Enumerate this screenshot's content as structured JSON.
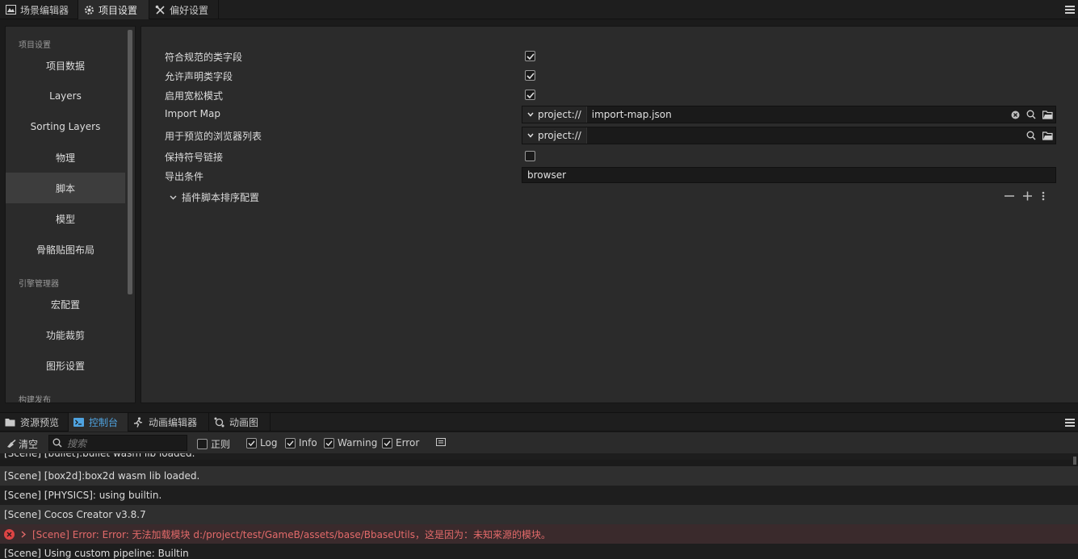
{
  "top_tabs": [
    {
      "label": "场景编辑器",
      "icon": "scene-icon"
    },
    {
      "label": "项目设置",
      "icon": "gear-icon",
      "active": true
    },
    {
      "label": "偏好设置",
      "icon": "tools-icon"
    }
  ],
  "nav": {
    "section_project": "项目设置",
    "items_project": [
      "项目数据",
      "Layers",
      "Sorting Layers",
      "物理",
      "脚本",
      "模型",
      "骨骼贴图布局"
    ],
    "active": "脚本",
    "section_engine": "引擎管理器",
    "items_engine": [
      "宏配置",
      "功能裁剪",
      "图形设置"
    ],
    "section_build": "构建发布"
  },
  "settings": {
    "strict_class_fields": {
      "label": "符合规范的类字段",
      "checked": true
    },
    "allow_declare_fields": {
      "label": "允许声明类字段",
      "checked": true
    },
    "loose_mode": {
      "label": "启用宽松模式",
      "checked": true
    },
    "import_map": {
      "label": "Import Map",
      "prefix": "project://",
      "value": "import-map.json"
    },
    "preview_browsers": {
      "label": "用于预览的浏览器列表",
      "prefix": "project://",
      "value": ""
    },
    "preserve_symlinks": {
      "label": "保持符号链接",
      "checked": false
    },
    "export_conditions": {
      "label": "导出条件",
      "value": "browser"
    },
    "plugin_order": {
      "label": "插件脚本排序配置"
    }
  },
  "bottom_tabs": [
    {
      "label": "资源预览",
      "icon": "folder-icon"
    },
    {
      "label": "控制台",
      "icon": "terminal-icon",
      "active": true
    },
    {
      "label": "动画编辑器",
      "icon": "runner-icon"
    },
    {
      "label": "动画图",
      "icon": "animgraph-icon"
    }
  ],
  "console_toolbar": {
    "clear_label": "清空",
    "search_placeholder": "搜索",
    "regex_label": "正则",
    "regex_checked": false,
    "log_label": "Log",
    "info_label": "Info",
    "warning_label": "Warning",
    "error_label": "Error"
  },
  "logs": [
    {
      "text": "[Scene] [bullet]:bullet wasm lib loaded.",
      "level": "log"
    },
    {
      "text": "[Scene] [box2d]:box2d wasm lib loaded.",
      "level": "log"
    },
    {
      "text": "[Scene] [PHYSICS]: using builtin.",
      "level": "log"
    },
    {
      "text": "[Scene] Cocos Creator v3.8.7",
      "level": "log"
    },
    {
      "text": "[Scene] Error: Error: 无法加载模块 d:/project/test/GameB/assets/base/BbaseUtils，这是因为：未知来源的模块。",
      "level": "error"
    },
    {
      "text": "[Scene] Using custom pipeline: Builtin",
      "level": "log"
    }
  ],
  "colors": {
    "accent": "#4fa3e0",
    "error": "#e36a6a",
    "panel": "#2b2b2b",
    "background": "#1b1b1b"
  }
}
